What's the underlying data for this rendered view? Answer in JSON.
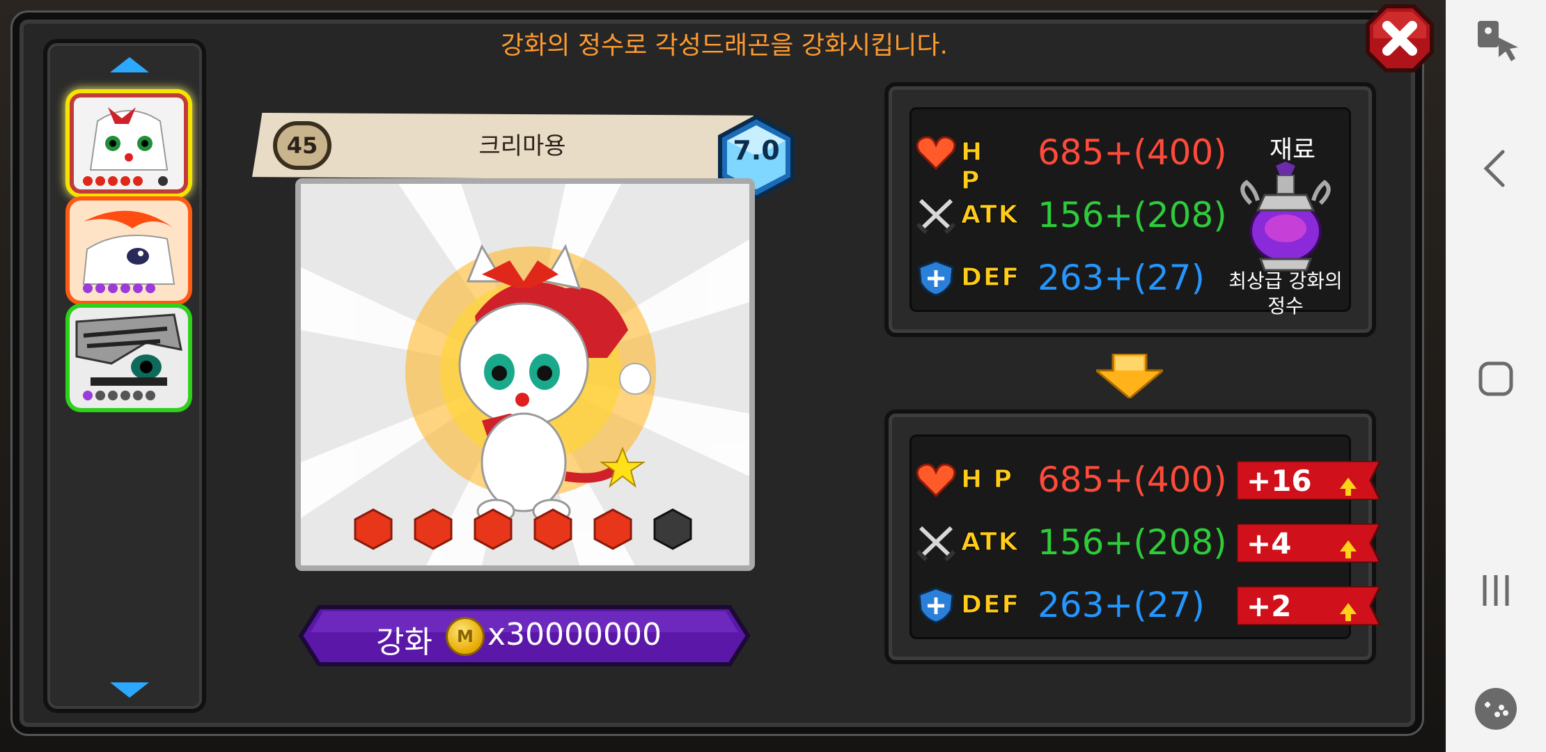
{
  "header": {
    "message": "강화의 정수로 각성드래곤을 강화시킵니다."
  },
  "character": {
    "level": "45",
    "name": "크리마용",
    "grade": "7.0",
    "stars_filled": 5,
    "stars_total": 6
  },
  "list": {
    "items": [
      {
        "name": "크리마용",
        "selected": true,
        "stars_filled": 5,
        "border": "#f5e400"
      },
      {
        "name": "dragon-2",
        "selected": false,
        "stars_filled": 6,
        "border": "#ff5a14"
      },
      {
        "name": "dragon-3",
        "selected": false,
        "stars_filled": 1,
        "border": "#2ed11a"
      }
    ]
  },
  "enhance": {
    "label": "강화",
    "coin_symbol": "M",
    "cost": "x30000000"
  },
  "current_stats": {
    "hp_label": "H P",
    "hp_value": "685+(400)",
    "atk_label": "ATK",
    "atk_value": "156+(208)",
    "def_label": "DEF",
    "def_value": "263+(27)"
  },
  "material": {
    "title": "재료",
    "name_line1": "최상급 강화의",
    "name_line2": "정수"
  },
  "after_stats": {
    "hp_label": "H P",
    "hp_value": "685+(400)",
    "hp_bonus": "+16",
    "atk_label": "ATK",
    "atk_value": "156+(208)",
    "atk_bonus": "+4",
    "def_label": "DEF",
    "def_value": "263+(27)",
    "def_bonus": "+2"
  },
  "colors": {
    "hp": "#ff4a3a",
    "atk": "#2ecc3a",
    "def": "#2496ff",
    "header": "#ff9a2e",
    "enhance_button": "#5b17a8"
  }
}
